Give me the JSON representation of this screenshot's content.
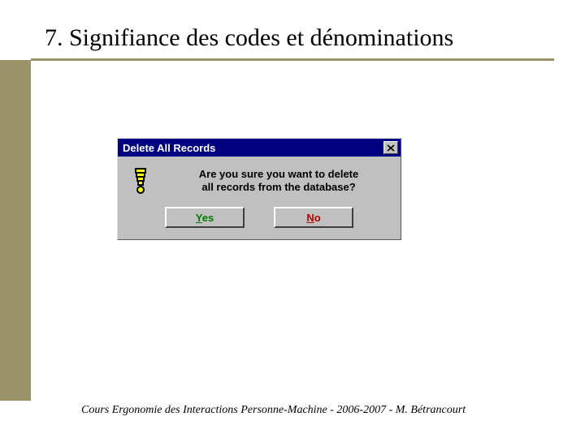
{
  "slide": {
    "title": "7. Signifiance des codes et dénominations",
    "footer": "Cours Ergonomie des Interactions Personne-Machine - 2006-2007 - M. Bétrancourt"
  },
  "dialog": {
    "title": "Delete All Records",
    "message_line1": "Are you sure you want to delete",
    "message_line2": "all records from the database?",
    "yes_hotkey": "Y",
    "yes_rest": "es",
    "no_hotkey": "N",
    "no_rest": "o"
  }
}
